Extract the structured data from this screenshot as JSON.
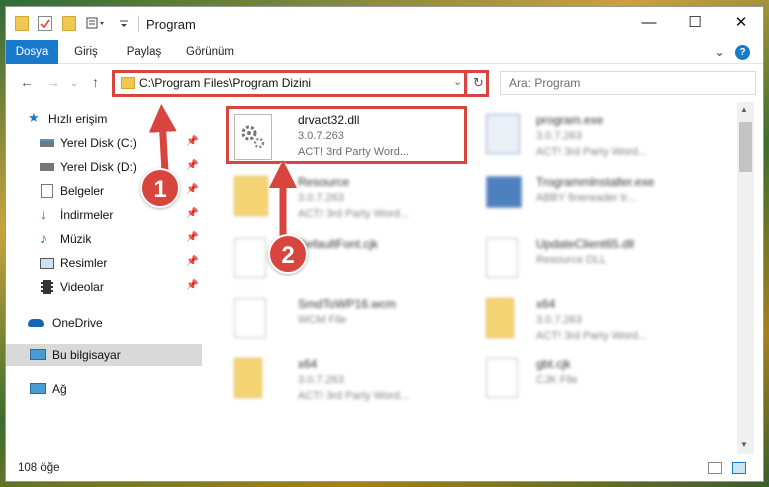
{
  "window": {
    "title": "Program",
    "controls": {
      "minimize": "—",
      "maximize": "☐",
      "close": "✕"
    }
  },
  "ribbon": {
    "tabs": [
      "Dosya",
      "Giriş",
      "Paylaş",
      "Görünüm"
    ],
    "active_tab": "Dosya",
    "help": "?"
  },
  "navigation": {
    "address": "C:\\Program Files\\Program Dizini",
    "search_placeholder": "Ara: Program"
  },
  "sidebar": {
    "items": [
      {
        "label": "Hızlı erişim",
        "icon": "star-icon",
        "pinned": false
      },
      {
        "label": "Yerel Disk (C:)",
        "icon": "drive-icon",
        "pinned": true
      },
      {
        "label": "Yerel Disk (D:)",
        "icon": "drive-icon",
        "pinned": true
      },
      {
        "label": "Belgeler",
        "icon": "documents-icon",
        "pinned": true
      },
      {
        "label": "İndirmeler",
        "icon": "downloads-icon",
        "pinned": true
      },
      {
        "label": "Müzik",
        "icon": "music-icon",
        "pinned": true
      },
      {
        "label": "Resimler",
        "icon": "pictures-icon",
        "pinned": true
      },
      {
        "label": "Videolar",
        "icon": "videos-icon",
        "pinned": true
      },
      {
        "label": "OneDrive",
        "icon": "cloud-icon",
        "pinned": false
      },
      {
        "label": "Bu bilgisayar",
        "icon": "computer-icon",
        "pinned": false,
        "selected": true
      },
      {
        "label": "Ağ",
        "icon": "network-icon",
        "pinned": false
      }
    ]
  },
  "files": [
    {
      "name": "drvact32.dll",
      "line1": "3.0.7.263",
      "line2": "ACT! 3rd Party Word...",
      "icon": "dll-gear-icon",
      "highlighted": true
    },
    {
      "name": "program.exe",
      "line1": "3.0.7.263",
      "line2": "ACT! 3rd Party Word...",
      "icon": "exe-icon"
    },
    {
      "name": "Resource",
      "line1": "3.0.7.263",
      "line2": "ACT! 3rd Party Word...",
      "icon": "folder-icon"
    },
    {
      "name": "Trogrammlnstaller.exe",
      "line1": "ABBY finereader tr...",
      "line2": "",
      "icon": "installer-icon"
    },
    {
      "name": "DefaultFont.cjk",
      "line1": "",
      "line2": "",
      "icon": "file-icon"
    },
    {
      "name": "UpdateClient65.dll",
      "line1": "Resource DLL",
      "line2": "",
      "icon": "dll-gear-icon"
    },
    {
      "name": "SmdToWP16.wcm",
      "line1": "WCM File",
      "line2": "",
      "icon": "file-icon"
    },
    {
      "name": "x64",
      "line1": "3.0.7.263",
      "line2": "ACT! 3rd Party Word...",
      "icon": "folder-icon"
    },
    {
      "name": "x64",
      "line1": "3.0.7.263",
      "line2": "ACT! 3rd Party Word...",
      "icon": "folder-icon"
    },
    {
      "name": "gbt.cjk",
      "line1": "CJK File",
      "line2": "",
      "icon": "file-icon"
    }
  ],
  "status": {
    "item_count": "108 öğe"
  },
  "annotations": {
    "step1": "1",
    "step2": "2",
    "color": "#d8453f"
  }
}
